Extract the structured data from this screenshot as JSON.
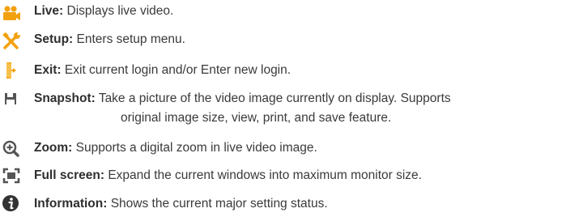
{
  "items": [
    {
      "icon": "live-camera-icon",
      "label": "Live:",
      "desc": "Displays live video."
    },
    {
      "icon": "setup-tools-icon",
      "label": "Setup:",
      "desc": "Enters setup menu."
    },
    {
      "icon": "exit-door-icon",
      "label": "Exit:",
      "desc": "Exit current login and/or Enter new login."
    },
    {
      "icon": "snapshot-floppy-icon",
      "label": "Snapshot:",
      "desc": "Take a picture of the video image currently on display. Supports",
      "desc2": "original image size, view, print, and save feature."
    },
    {
      "icon": "zoom-magnifier-icon",
      "label": "Zoom:",
      "desc": "Supports a digital zoom in live video image."
    },
    {
      "icon": "fullscreen-icon",
      "label": "Full screen:",
      "desc": "Expand the current windows into maximum monitor size."
    },
    {
      "icon": "information-icon",
      "label": "Information:",
      "desc": "Shows the current major setting status."
    }
  ],
  "colors": {
    "orange": "#f2a10e",
    "gray": "#555555"
  }
}
